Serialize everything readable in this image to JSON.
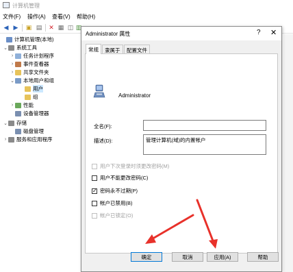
{
  "window": {
    "title": "计算机管理"
  },
  "menu": [
    "文件(F)",
    "操作(A)",
    "查看(V)",
    "帮助(H)"
  ],
  "toolbar": [
    "back-icon",
    "forward-icon",
    "up-icon",
    "show-tree-icon",
    "delete-icon",
    "properties-icon",
    "refresh-icon",
    "export-icon",
    "help-icon",
    "console-icon"
  ],
  "tree": [
    {
      "label": "计算机管理(本地)",
      "expander": "",
      "icon": "computer-icon",
      "color": "#6b8fc7"
    },
    {
      "label": "系统工具",
      "expander": "⌄",
      "icon": "tools-icon",
      "color": "#8a8a8a"
    },
    {
      "label": "任务计划程序",
      "expander": "›",
      "icon": "task-scheduler-icon",
      "color": "#8fb0d9"
    },
    {
      "label": "事件查看器",
      "expander": "›",
      "icon": "event-viewer-icon",
      "color": "#c07a4a"
    },
    {
      "label": "共享文件夹",
      "expander": "›",
      "icon": "shared-folder-icon",
      "color": "#e7c35a"
    },
    {
      "label": "本地用户和组",
      "expander": "⌄",
      "icon": "users-groups-icon",
      "color": "#7a9bc7"
    },
    {
      "label": "用户",
      "expander": "",
      "icon": "folder-icon",
      "color": "#e7c35a"
    },
    {
      "label": "组",
      "expander": "",
      "icon": "folder-icon",
      "color": "#e7c35a"
    },
    {
      "label": "性能",
      "expander": "›",
      "icon": "performance-icon",
      "color": "#6aa85b"
    },
    {
      "label": "设备管理器",
      "expander": "",
      "icon": "device-manager-icon",
      "color": "#7a8fb0"
    },
    {
      "label": "存储",
      "expander": "⌄",
      "icon": "storage-icon",
      "color": "#8a8a8a"
    },
    {
      "label": "磁盘管理",
      "expander": "",
      "icon": "disk-management-icon",
      "color": "#7a8fb0"
    },
    {
      "label": "服务和应用程序",
      "expander": "›",
      "icon": "services-icon",
      "color": "#8a8a8a"
    }
  ],
  "dialog": {
    "title": "Administrator 属性",
    "help": "?",
    "close": "✕",
    "tabs": [
      "常规",
      "隶属于",
      "配置文件"
    ],
    "username": "Administrator",
    "fullname_label": "全名(F):",
    "fullname_value": "",
    "description_label": "描述(D):",
    "description_value": "管理计算机(域)的内置帐户",
    "checkboxes": [
      {
        "label": "用户下次登录时须更改密码(M)",
        "checked": false,
        "disabled": true
      },
      {
        "label": "用户不能更改密码(C)",
        "checked": false,
        "disabled": false
      },
      {
        "label": "密码永不过期(P)",
        "checked": true,
        "disabled": false
      },
      {
        "label": "帐户已禁用(B)",
        "checked": false,
        "disabled": false
      },
      {
        "label": "帐户已锁定(O)",
        "checked": false,
        "disabled": true
      }
    ],
    "buttons": [
      "确定",
      "取消",
      "应用(A)",
      "帮助"
    ]
  },
  "colors": {
    "arrow": "#e8312a",
    "accent": "#0078d7"
  }
}
